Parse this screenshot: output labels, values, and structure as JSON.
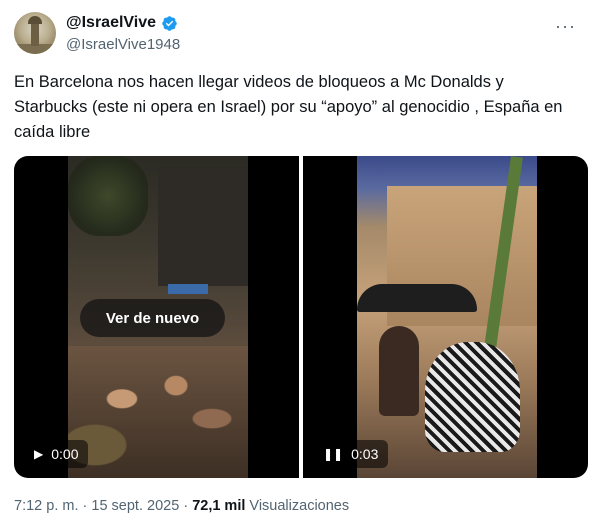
{
  "author": {
    "display_name": "@IsraelVive",
    "handle": "@IsraelVive1948",
    "verified": true,
    "more_icon": "ellipsis-icon"
  },
  "tweet": {
    "text": "En Barcelona nos hacen llegar videos de bloqueos a Mc Donalds y Starbucks (este ni opera en Israel) por su “apoyo” al genocidio , España en caída libre"
  },
  "media": {
    "videos": [
      {
        "overlay_label": "Ver de nuevo",
        "control_icon": "play-icon",
        "time": "0:00"
      },
      {
        "control_icon": "pause-icon",
        "time": "0:03"
      }
    ]
  },
  "meta": {
    "time": "7:12 p. m.",
    "separator": "·",
    "date": "15 sept. 2025",
    "views_count": "72,1 mil",
    "views_label": "Visualizaciones"
  },
  "colors": {
    "verified_badge": "#1d9bf0",
    "secondary_text": "#536471",
    "primary_text": "#0f1419"
  }
}
